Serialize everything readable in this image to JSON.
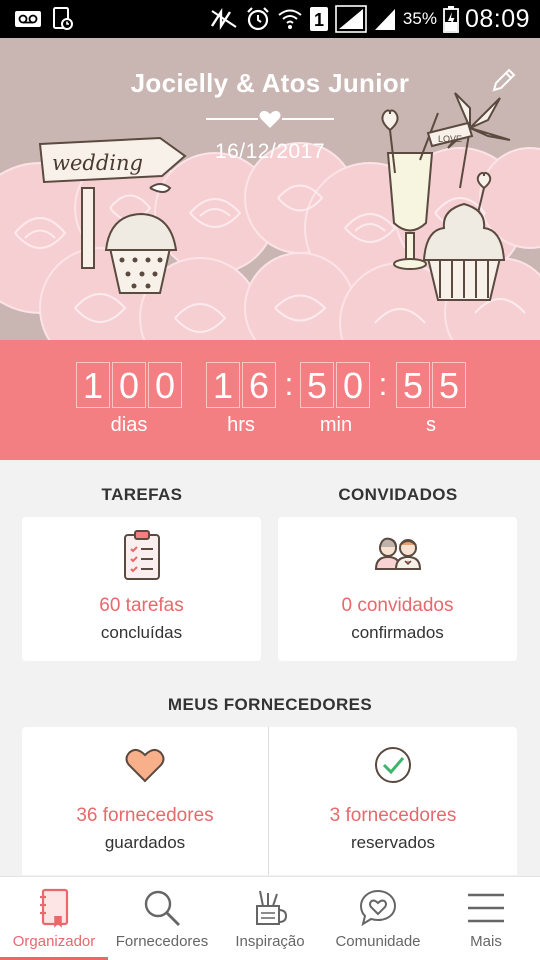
{
  "status_bar": {
    "battery_percent": "35%",
    "time": "08:09",
    "sim_slot": "1"
  },
  "header": {
    "couple_name": "Jocielly & Atos Junior",
    "date": "16/12/2017",
    "sign_text": "wedding",
    "flag_text": "LOVE"
  },
  "countdown": {
    "days": [
      "1",
      "0",
      "0"
    ],
    "hours": [
      "1",
      "6"
    ],
    "minutes": [
      "5",
      "0"
    ],
    "seconds": [
      "5",
      "5"
    ],
    "labels": {
      "days": "dias",
      "hours": "hrs",
      "minutes": "min",
      "seconds": "s"
    }
  },
  "tasks": {
    "title": "TAREFAS",
    "count_text": "60 tarefas",
    "sub_text": "concluídas",
    "icon": "clipboard-icon"
  },
  "guests": {
    "title": "CONVIDADOS",
    "count_text": "0 convidados",
    "sub_text": "confirmados",
    "icon": "couple-icon"
  },
  "vendors": {
    "title": "MEUS FORNECEDORES",
    "saved": {
      "count_text": "36 fornecedores",
      "sub_text": "guardados",
      "icon": "heart-icon"
    },
    "booked": {
      "count_text": "3 fornecedores",
      "sub_text": "reservados",
      "icon": "check-circle-icon"
    }
  },
  "bottom_nav": {
    "items": [
      {
        "label": "Organizador",
        "icon": "notebook-icon",
        "active": true
      },
      {
        "label": "Fornecedores",
        "icon": "search-icon",
        "active": false
      },
      {
        "label": "Inspiração",
        "icon": "cup-pencils-icon",
        "active": false
      },
      {
        "label": "Comunidade",
        "icon": "chat-heart-icon",
        "active": false
      },
      {
        "label": "Mais",
        "icon": "menu-icon",
        "active": false
      }
    ]
  },
  "colors": {
    "accent": "#e8686c",
    "countdown_bg": "#f47f83",
    "header_bg": "#c9b6b2",
    "roses": "#f6cfd3"
  }
}
